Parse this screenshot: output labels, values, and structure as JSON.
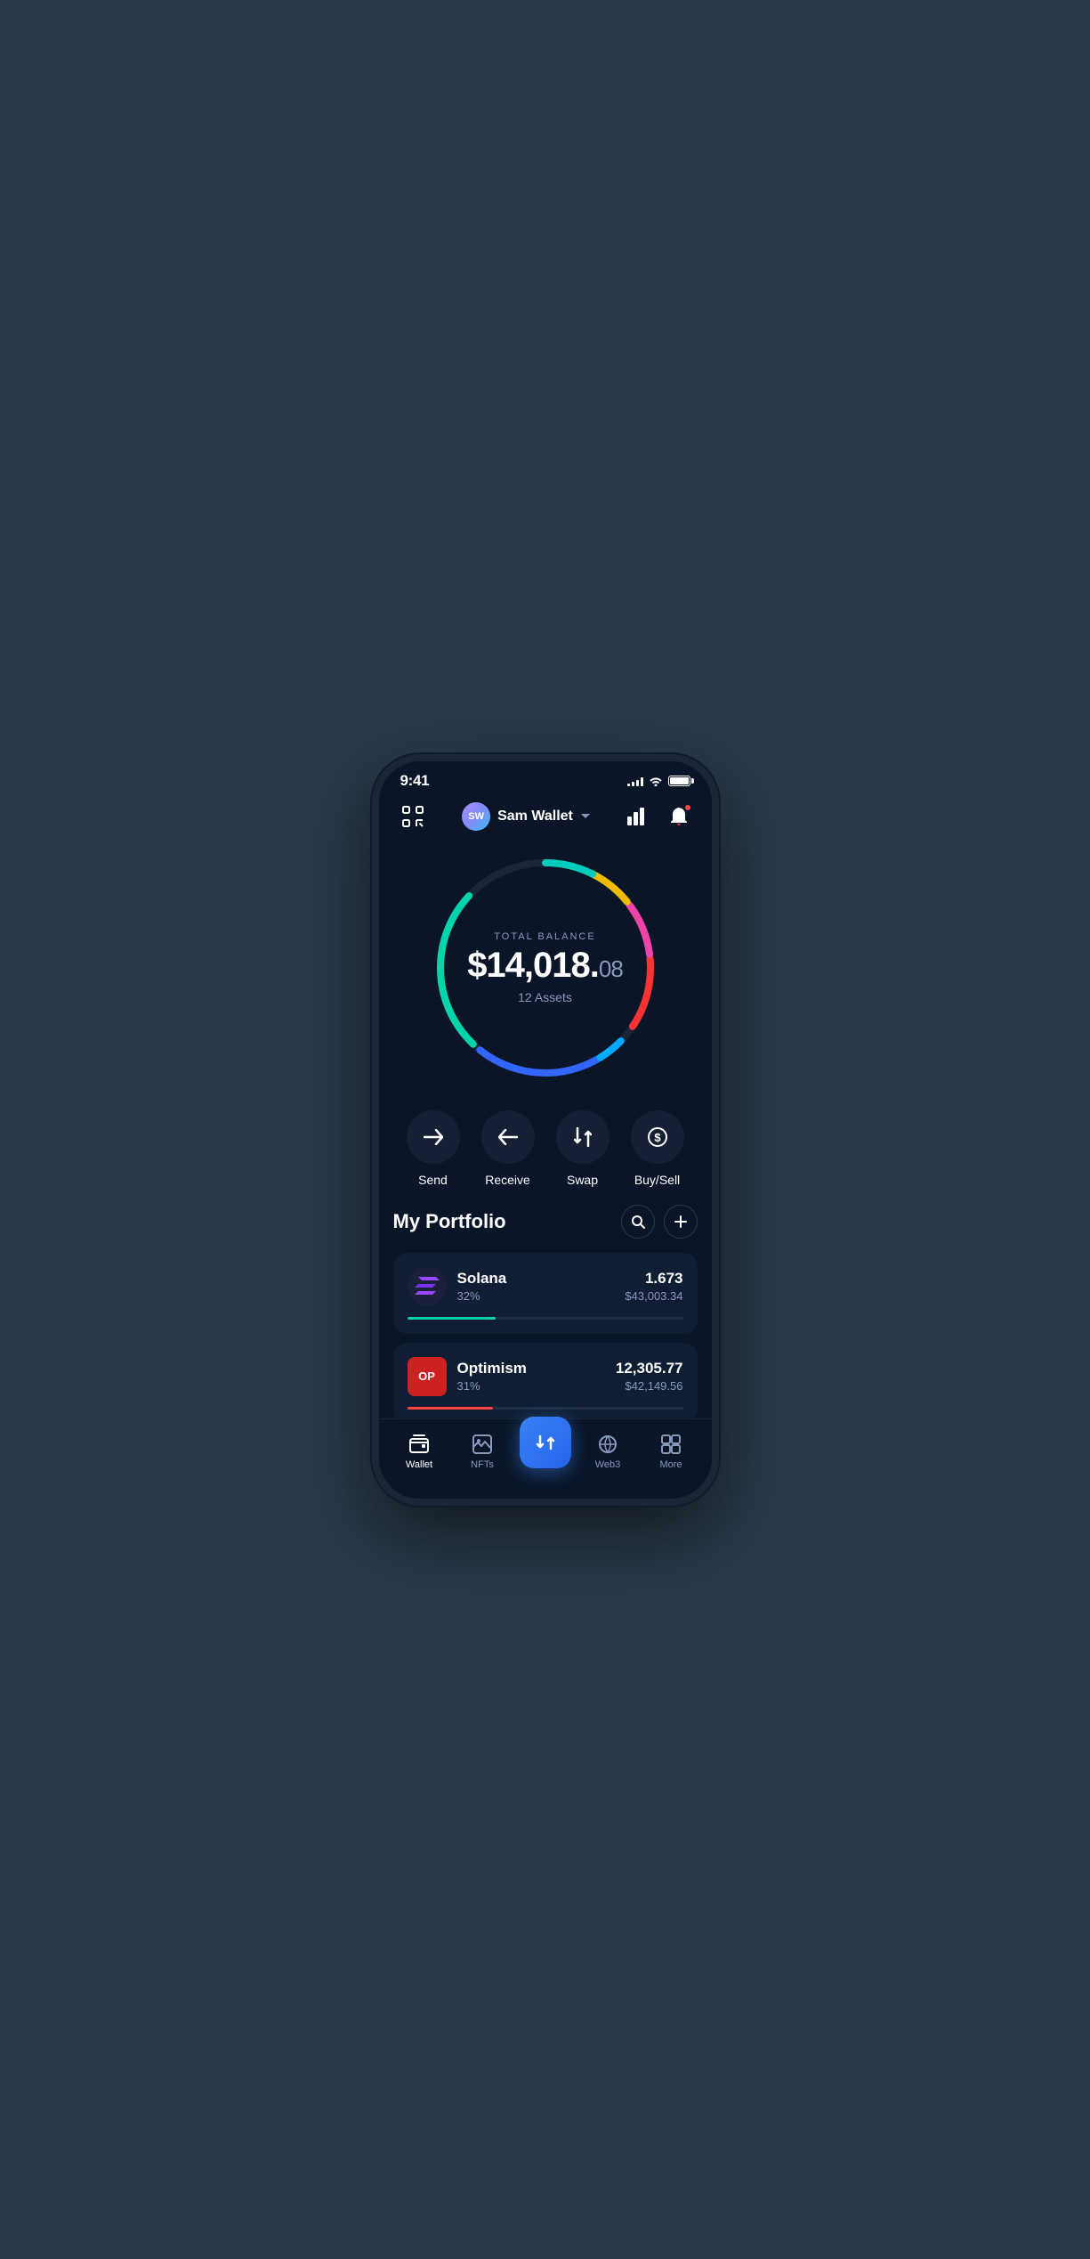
{
  "status": {
    "time": "9:41",
    "signal_bars": [
      3,
      5,
      7,
      9,
      11
    ],
    "battery_full": true
  },
  "header": {
    "scan_label": "scan",
    "wallet_initials": "SW",
    "wallet_name": "Sam Wallet",
    "dropdown_label": "dropdown",
    "chart_label": "chart",
    "notification_label": "notifications"
  },
  "balance": {
    "label": "TOTAL BALANCE",
    "main": "$14,018.",
    "cents": "08",
    "assets_label": "12 Assets"
  },
  "actions": [
    {
      "id": "send",
      "label": "Send",
      "icon": "→"
    },
    {
      "id": "receive",
      "label": "Receive",
      "icon": "←"
    },
    {
      "id": "swap",
      "label": "Swap",
      "icon": "⇅"
    },
    {
      "id": "buysell",
      "label": "Buy/Sell",
      "icon": "$"
    }
  ],
  "portfolio": {
    "title": "My Portfolio",
    "search_label": "search",
    "add_label": "add",
    "assets": [
      {
        "id": "solana",
        "name": "Solana",
        "percent": "32%",
        "amount": "1.673",
        "usd": "$43,003.34",
        "progress": 32,
        "progress_color": "#00d4aa",
        "icon_text": "◎"
      },
      {
        "id": "optimism",
        "name": "Optimism",
        "percent": "31%",
        "amount": "12,305.77",
        "usd": "$42,149.56",
        "progress": 31,
        "progress_color": "#ff4444",
        "icon_text": "OP"
      }
    ]
  },
  "nav": {
    "items": [
      {
        "id": "wallet",
        "label": "Wallet",
        "active": true
      },
      {
        "id": "nfts",
        "label": "NFTs",
        "active": false
      },
      {
        "id": "swap_center",
        "label": "",
        "active": false,
        "is_center": true
      },
      {
        "id": "web3",
        "label": "Web3",
        "active": false
      },
      {
        "id": "more",
        "label": "More",
        "active": false
      }
    ]
  },
  "colors": {
    "bg": "#0a1628",
    "card": "#0f1e32",
    "accent_blue": "#3b82f6",
    "accent_teal": "#00d4aa",
    "text_dim": "#8899bb"
  }
}
